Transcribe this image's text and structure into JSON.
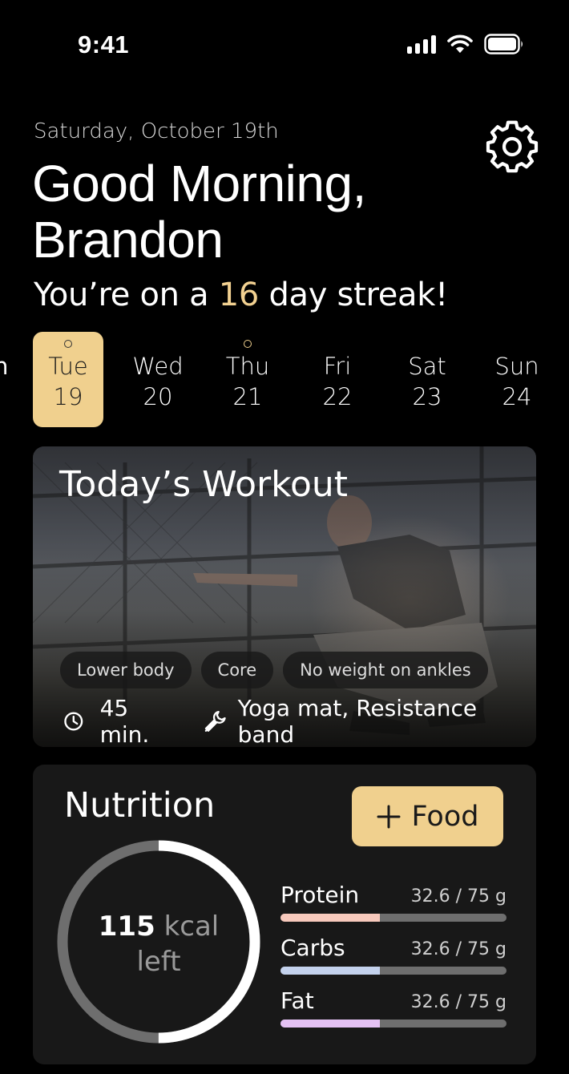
{
  "status_bar": {
    "time": "9:41"
  },
  "header": {
    "date": "Saturday, October 19th",
    "greeting": "Good Morning, Brandon",
    "streak_prefix": "You’re on a",
    "streak_days": "16",
    "streak_suffix": "day streak!"
  },
  "week": {
    "partial_day": "n",
    "days": [
      {
        "name": "Tue",
        "num": "19",
        "active": true,
        "has_dot": true
      },
      {
        "name": "Wed",
        "num": "20",
        "active": false,
        "has_dot": false
      },
      {
        "name": "Thu",
        "num": "21",
        "active": false,
        "has_dot": true
      },
      {
        "name": "Fri",
        "num": "22",
        "active": false,
        "has_dot": false
      },
      {
        "name": "Sat",
        "num": "23",
        "active": false,
        "has_dot": false
      },
      {
        "name": "Sun",
        "num": "24",
        "active": false,
        "has_dot": false
      }
    ]
  },
  "workout": {
    "title": "Today’s Workout",
    "tags": [
      "Lower body",
      "Core",
      "No weight on ankles"
    ],
    "duration": "45 min.",
    "equipment": "Yoga mat, Resistance band"
  },
  "nutrition": {
    "title": "Nutrition",
    "add_button": "Food",
    "kcal_value": "115",
    "kcal_unit": "kcal",
    "kcal_suffix": "left",
    "ring_progress": 0.5,
    "macros": [
      {
        "name": "Protein",
        "value": "32.6 / 75 g",
        "progress": 0.44,
        "color": "#f7c9bc"
      },
      {
        "name": "Carbs",
        "value": "32.6 / 75 g",
        "progress": 0.44,
        "color": "#c3d1ec"
      },
      {
        "name": "Fat",
        "value": "32.6 / 75 g",
        "progress": 0.44,
        "color": "#e4c1f3"
      }
    ]
  },
  "colors": {
    "accent": "#f0d08e",
    "background": "#000000",
    "card": "#181818"
  }
}
